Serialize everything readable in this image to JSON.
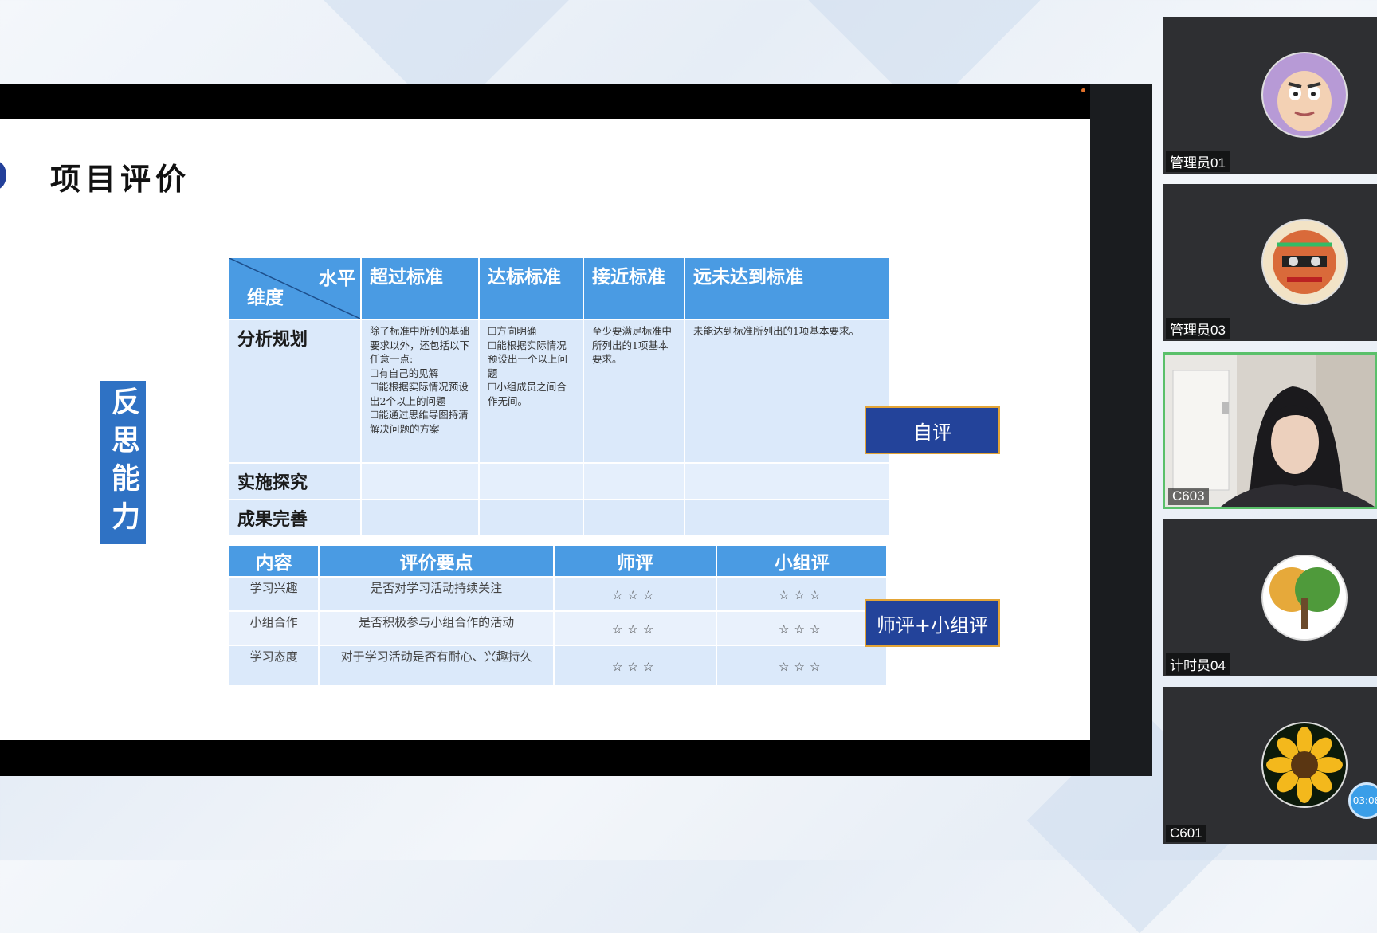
{
  "slide": {
    "title": "项目评价",
    "vertical_label": "反思能力",
    "rubric": {
      "header_level": "水平",
      "header_dimension": "维度",
      "columns": [
        "超过标准",
        "达标标准",
        "接近标准",
        "远未达到标准"
      ],
      "rows": [
        {
          "label": "分析规划",
          "cells": [
            "除了标准中所列的基础要求以外，还包括以下任意一点:\n☐有自己的见解\n☐能根据实际情况预设出2个以上的问题\n☐能通过思维导图捋清解决问题的方案",
            "☐方向明确\n☐能根据实际情况预设出一个以上问题\n☐小组成员之间合作无间。",
            "至少要满足标准中所列出的1项基本要求。",
            "未能达到标准所列出的1项基本要求。"
          ]
        },
        {
          "label": "实施探究",
          "cells": [
            "",
            "",
            "",
            ""
          ]
        },
        {
          "label": "成果完善",
          "cells": [
            "",
            "",
            "",
            ""
          ]
        }
      ]
    },
    "evaluation": {
      "headers": [
        "内容",
        "评价要点",
        "师评",
        "小组评"
      ],
      "rows": [
        {
          "content": "学习兴趣",
          "point": "是否对学习活动持续关注",
          "teacher": "☆☆☆",
          "group": "☆☆☆"
        },
        {
          "content": "小组合作",
          "point": "是否积极参与小组合作的活动",
          "teacher": "☆☆☆",
          "group": "☆☆☆"
        },
        {
          "content": "学习态度",
          "point": "对于学习活动是否有耐心、兴趣持久",
          "teacher": "☆☆☆",
          "group": "☆☆☆"
        }
      ]
    },
    "buttons": {
      "self_eval": "自评",
      "teacher_group_eval": "师评+小组评"
    }
  },
  "participants": [
    {
      "name": "管理员01",
      "avatar": "buzz-cartoon-avatar",
      "active": false
    },
    {
      "name": "管理员03",
      "avatar": "colorful-mask-avatar",
      "active": false
    },
    {
      "name": "C603",
      "avatar": "camera-video-woman",
      "active": true
    },
    {
      "name": "计时员04",
      "avatar": "tree-avatar",
      "active": false
    },
    {
      "name": "C601",
      "avatar": "sunflower-avatar",
      "active": false
    }
  ],
  "timer": {
    "text": "03:08"
  },
  "colors": {
    "header_blue": "#4a9be3",
    "cell_blue": "#dbe9fa",
    "button_navy": "#23439a",
    "active_border": "#5ac06a"
  }
}
